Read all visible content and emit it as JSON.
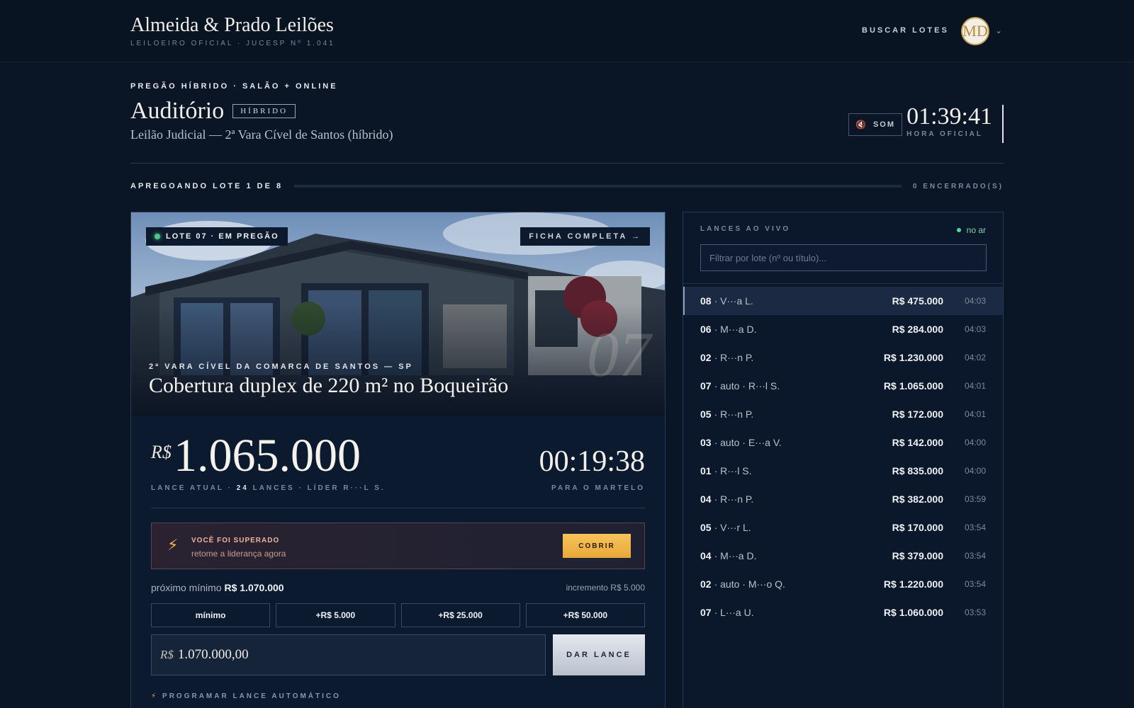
{
  "brand": {
    "title": "Almeida & Prado Leilões",
    "subtitle": "LEILOEIRO OFICIAL · JUCESP Nº 1.041"
  },
  "topnav": {
    "search_label": "BUSCAR LOTES",
    "avatar_initials": "MD"
  },
  "auction": {
    "eyebrow": "PREGÃO HÍBRIDO · SALÃO + ONLINE",
    "room": "Auditório",
    "badge": "HÍBRIDO",
    "subtitle": "Leilão Judicial — 2ª Vara Cível de Santos (híbrido)",
    "sound_label": "SOM",
    "clock_time": "01:39:41",
    "clock_label": "HORA OFICIAL"
  },
  "progress": {
    "label": "APREGOANDO LOTE 1 DE 8",
    "right": "0 ENCERRADO(S)",
    "fraction": 0.0
  },
  "lot": {
    "status_badge": "LOTE 07 · EM PREGÃO",
    "ficha_label": "FICHA COMPLETA →",
    "court": "2ª VARA CÍVEL DA COMARCA DE SANTOS — SP",
    "title": "Cobertura duplex de 220 m² no Boqueirão",
    "number_ghost": "07",
    "currency": "R$",
    "current_price": "1.065.000",
    "meta_prefix": "LANCE ATUAL · ",
    "meta_count": "24",
    "meta_suffix": " LANCES · LÍDER R···L S.",
    "countdown": "00:19:38",
    "countdown_label": "PARA O MARTELO"
  },
  "alert": {
    "title": "VOCÊ FOI SUPERADO",
    "sub": "retome a liderança agora",
    "button": "COBRIR"
  },
  "next_min": {
    "label": "próximo mínimo",
    "value": "R$ 1.070.000",
    "increment": "incremento R$ 5.000"
  },
  "quick_bids": [
    "mínimo",
    "+R$ 5.000",
    "+R$ 25.000",
    "+R$ 50.000"
  ],
  "bid_input": {
    "currency": "R$",
    "value": "1.070.000,00"
  },
  "give_bid_label": "DAR LANCE",
  "auto_bid_label": "PROGRAMAR LANCE AUTOMÁTICO",
  "live": {
    "title": "LANCES AO VIVO",
    "status": "no ar",
    "filter_placeholder": "Filtrar por lote (nº ou título)...",
    "bids": [
      {
        "lot": "08",
        "who": "· V···a L.",
        "amount": "R$ 475.000",
        "time": "04:03"
      },
      {
        "lot": "06",
        "who": "· M···a D.",
        "amount": "R$ 284.000",
        "time": "04:03"
      },
      {
        "lot": "02",
        "who": "· R···n P.",
        "amount": "R$ 1.230.000",
        "time": "04:02"
      },
      {
        "lot": "07",
        "who": "· auto · R···l S.",
        "amount": "R$ 1.065.000",
        "time": "04:01"
      },
      {
        "lot": "05",
        "who": "· R···n P.",
        "amount": "R$ 172.000",
        "time": "04:01"
      },
      {
        "lot": "03",
        "who": "· auto · E···a V.",
        "amount": "R$ 142.000",
        "time": "04:00"
      },
      {
        "lot": "01",
        "who": "· R···l S.",
        "amount": "R$ 835.000",
        "time": "04:00"
      },
      {
        "lot": "04",
        "who": "· R···n P.",
        "amount": "R$ 382.000",
        "time": "03:59"
      },
      {
        "lot": "05",
        "who": "· V···r L.",
        "amount": "R$ 170.000",
        "time": "03:54"
      },
      {
        "lot": "04",
        "who": "· M···a D.",
        "amount": "R$ 379.000",
        "time": "03:54"
      },
      {
        "lot": "02",
        "who": "· auto · M···o Q.",
        "amount": "R$ 1.220.000",
        "time": "03:54"
      },
      {
        "lot": "07",
        "who": "· L···a U.",
        "amount": "R$ 1.060.000",
        "time": "03:53"
      }
    ]
  },
  "colors": {
    "background": "#0a1526",
    "accent_gold": "#e7a83a",
    "live_green": "#4fc58a",
    "alert_red": "#f0b3a0"
  }
}
